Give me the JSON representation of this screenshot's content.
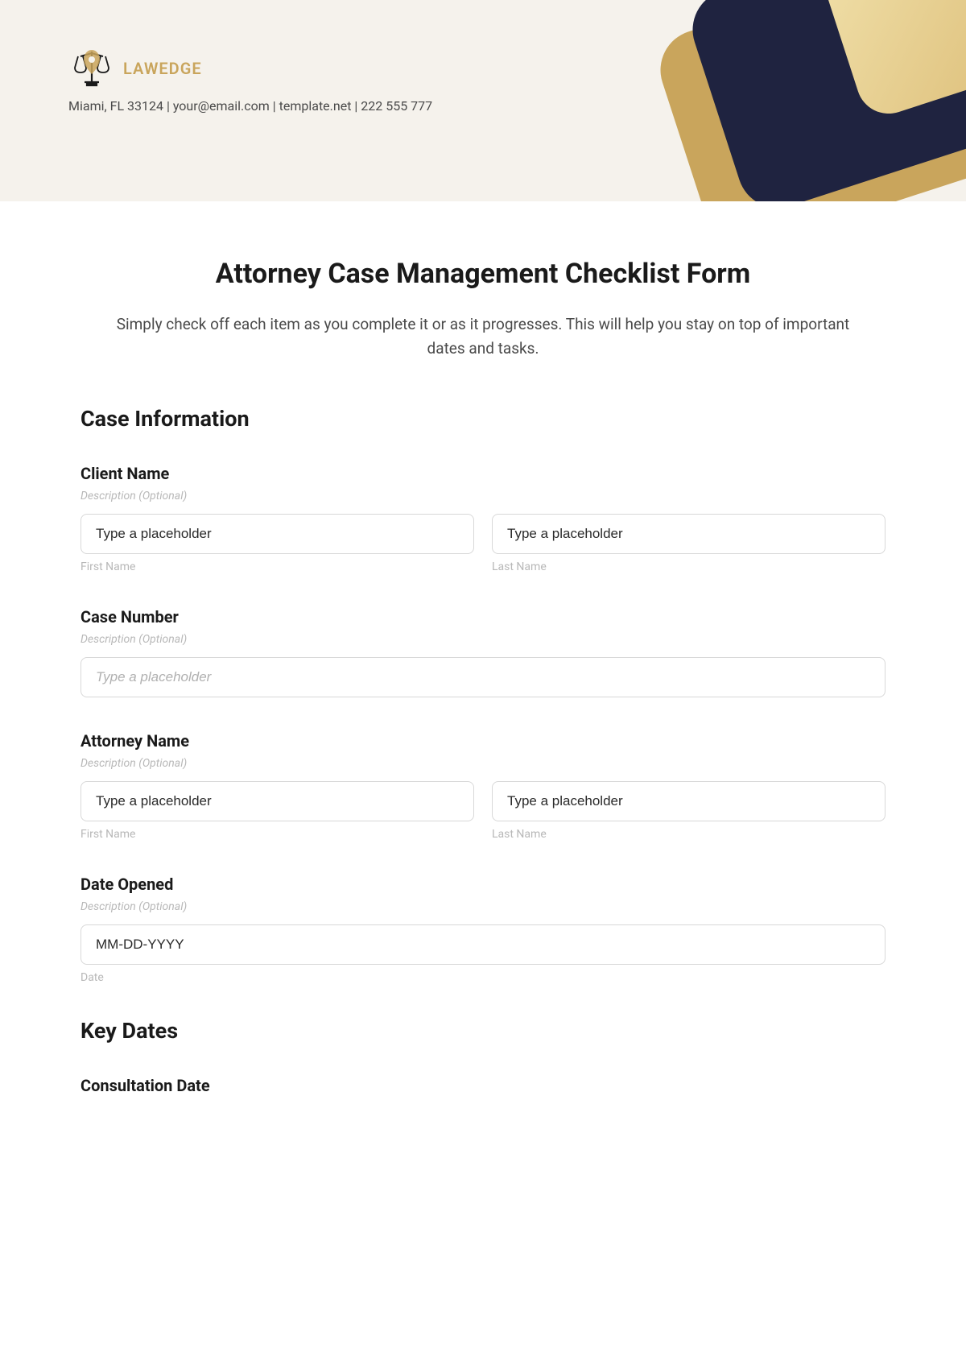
{
  "header": {
    "brand_name": "LAWEDGE",
    "contact_line": "Miami, FL 33124 | your@email.com | template.net | 222 555 777"
  },
  "form": {
    "title": "Attorney Case Management Checklist Form",
    "subtitle": "Simply check off each item as you complete it or as it progresses. This will help you stay on top of important dates and tasks."
  },
  "sections": {
    "case_info": {
      "heading": "Case Information",
      "client_name": {
        "label": "Client Name",
        "desc": "Description (Optional)",
        "first_placeholder": "Type a placeholder",
        "last_placeholder": "Type a placeholder",
        "first_sublabel": "First Name",
        "last_sublabel": "Last Name"
      },
      "case_number": {
        "label": "Case Number",
        "desc": "Description (Optional)",
        "placeholder": "Type a placeholder"
      },
      "attorney_name": {
        "label": "Attorney Name",
        "desc": "Description (Optional)",
        "first_placeholder": "Type a placeholder",
        "last_placeholder": "Type a placeholder",
        "first_sublabel": "First Name",
        "last_sublabel": "Last Name"
      },
      "date_opened": {
        "label": "Date Opened",
        "desc": "Description (Optional)",
        "placeholder": "MM-DD-YYYY",
        "sublabel": "Date"
      }
    },
    "key_dates": {
      "heading": "Key Dates",
      "consultation": {
        "label": "Consultation Date"
      }
    }
  }
}
